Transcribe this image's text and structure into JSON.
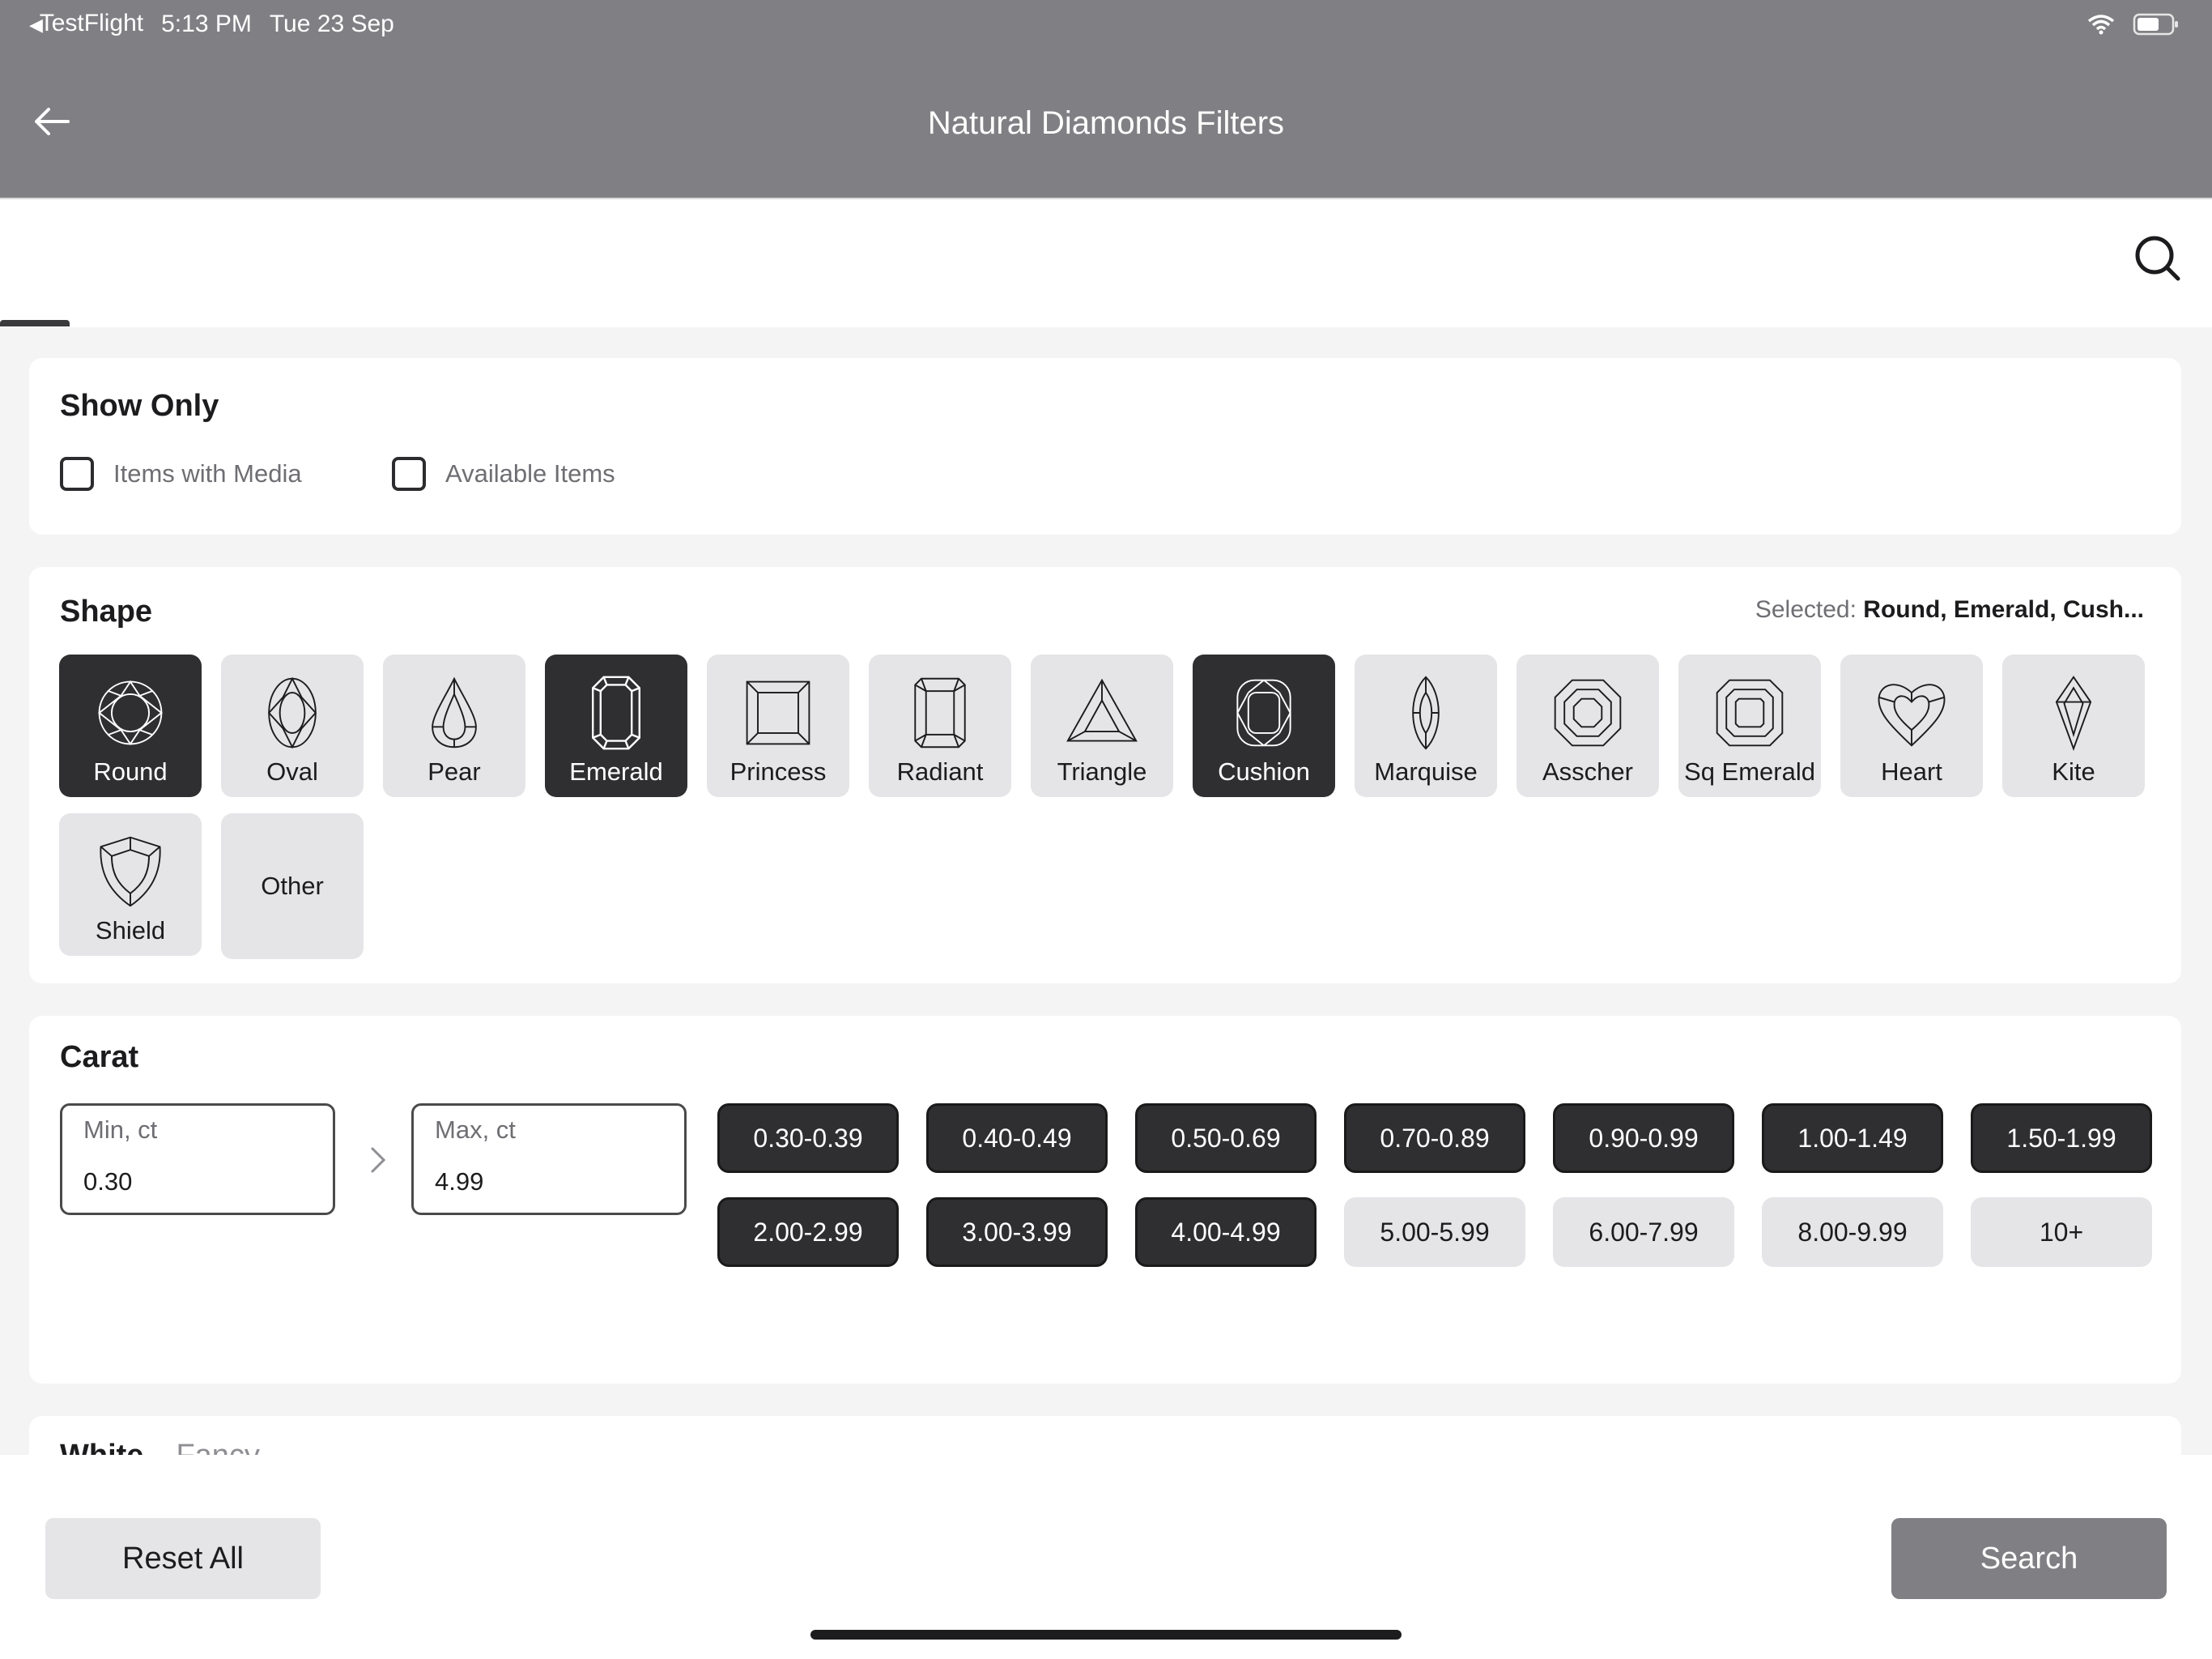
{
  "status_bar": {
    "back_app": "TestFlight",
    "time": "5:13 PM",
    "date": "Tue 23 Sep"
  },
  "nav": {
    "title": "Natural Diamonds Filters",
    "back_icon": "arrow-left-icon"
  },
  "search": {
    "icon": "search-icon"
  },
  "show_only": {
    "title": "Show Only",
    "options": [
      {
        "label": "Items with Media",
        "checked": false
      },
      {
        "label": "Available Items",
        "checked": false
      }
    ]
  },
  "shape": {
    "title": "Shape",
    "selected_prefix": "Selected:",
    "selected_value": "Round, Emerald, Cush...",
    "items": [
      {
        "label": "Round",
        "selected": true,
        "icon": "round-diamond-icon"
      },
      {
        "label": "Oval",
        "selected": false,
        "icon": "oval-diamond-icon"
      },
      {
        "label": "Pear",
        "selected": false,
        "icon": "pear-diamond-icon"
      },
      {
        "label": "Emerald",
        "selected": true,
        "icon": "emerald-diamond-icon"
      },
      {
        "label": "Princess",
        "selected": false,
        "icon": "princess-diamond-icon"
      },
      {
        "label": "Radiant",
        "selected": false,
        "icon": "radiant-diamond-icon"
      },
      {
        "label": "Triangle",
        "selected": false,
        "icon": "triangle-diamond-icon"
      },
      {
        "label": "Cushion",
        "selected": true,
        "icon": "cushion-diamond-icon"
      },
      {
        "label": "Marquise",
        "selected": false,
        "icon": "marquise-diamond-icon"
      },
      {
        "label": "Asscher",
        "selected": false,
        "icon": "asscher-diamond-icon"
      },
      {
        "label": "Sq Emerald",
        "selected": false,
        "icon": "sq-emerald-diamond-icon"
      },
      {
        "label": "Heart",
        "selected": false,
        "icon": "heart-diamond-icon"
      },
      {
        "label": "Kite",
        "selected": false,
        "icon": "kite-diamond-icon"
      },
      {
        "label": "Shield",
        "selected": false,
        "icon": "shield-diamond-icon"
      },
      {
        "label": "Other",
        "selected": false,
        "icon": ""
      }
    ]
  },
  "carat": {
    "title": "Carat",
    "min_placeholder": "Min, ct",
    "min_value": "0.30",
    "max_placeholder": "Max, ct",
    "max_value": "4.99",
    "ranges": [
      {
        "label": "0.30-0.39",
        "selected": true
      },
      {
        "label": "0.40-0.49",
        "selected": true
      },
      {
        "label": "0.50-0.69",
        "selected": true
      },
      {
        "label": "0.70-0.89",
        "selected": true
      },
      {
        "label": "0.90-0.99",
        "selected": true
      },
      {
        "label": "1.00-1.49",
        "selected": true
      },
      {
        "label": "1.50-1.99",
        "selected": true
      },
      {
        "label": "2.00-2.99",
        "selected": true
      },
      {
        "label": "3.00-3.99",
        "selected": true
      },
      {
        "label": "4.00-4.99",
        "selected": true
      },
      {
        "label": "5.00-5.99",
        "selected": false
      },
      {
        "label": "6.00-7.99",
        "selected": false
      },
      {
        "label": "8.00-9.99",
        "selected": false
      },
      {
        "label": "10+",
        "selected": false
      }
    ]
  },
  "color_tabs": {
    "white": "White",
    "fancy": "Fancy"
  },
  "footer": {
    "reset_label": "Reset All",
    "search_label": "Search"
  },
  "colors": {
    "header_bg": "#808084",
    "selected_bg": "#2f2f31",
    "unselected_bg": "#e5e5e7",
    "page_bg": "#f4f4f4"
  }
}
